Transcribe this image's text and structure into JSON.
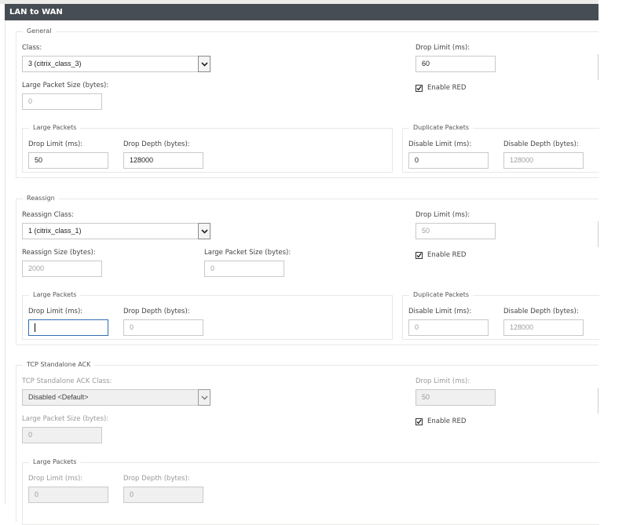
{
  "header": {
    "title": "LAN to WAN"
  },
  "general": {
    "legend": "General",
    "class": {
      "label": "Class:",
      "value": "3 (citrix_class_3)"
    },
    "large_packet_size": {
      "label": "Large Packet Size (bytes):",
      "placeholder": "0"
    },
    "drop_limit": {
      "label": "Drop Limit (ms):",
      "value": "60"
    },
    "enable_red": {
      "label": "Enable RED",
      "checked": true
    },
    "large_packets": {
      "legend": "Large Packets",
      "drop_limit": {
        "label": "Drop Limit (ms):",
        "value": "50"
      },
      "drop_depth": {
        "label": "Drop Depth (bytes):",
        "value": "128000"
      }
    },
    "duplicate_packets": {
      "legend": "Duplicate Packets",
      "disable_limit": {
        "label": "Disable Limit (ms):",
        "value": "0"
      },
      "disable_depth": {
        "label": "Disable Depth (bytes):",
        "placeholder": "128000"
      }
    }
  },
  "reassign": {
    "legend": "Reassign",
    "class": {
      "label": "Reassign Class:",
      "value": "1 (citrix_class_1)"
    },
    "reassign_size": {
      "label": "Reassign Size (bytes):",
      "placeholder": "2000"
    },
    "large_packet_size": {
      "label": "Large Packet Size (bytes):",
      "placeholder": "0"
    },
    "drop_limit": {
      "label": "Drop Limit (ms):",
      "placeholder": "50"
    },
    "enable_red": {
      "label": "Enable RED",
      "checked": true
    },
    "large_packets": {
      "legend": "Large Packets",
      "drop_limit": {
        "label": "Drop Limit (ms):",
        "value": ""
      },
      "drop_depth": {
        "label": "Drop Depth (bytes):",
        "placeholder": "0"
      }
    },
    "duplicate_packets": {
      "legend": "Duplicate Packets",
      "disable_limit": {
        "label": "Disable Limit (ms):",
        "placeholder": "0"
      },
      "disable_depth": {
        "label": "Disable Depth (bytes):",
        "placeholder": "128000"
      }
    }
  },
  "tcp_ack": {
    "legend": "TCP Standalone ACK",
    "class": {
      "label": "TCP Standalone ACK Class:",
      "value": "Disabled <Default>"
    },
    "large_packet_size": {
      "label": "Large Packet Size (bytes):",
      "value": "0"
    },
    "drop_limit": {
      "label": "Drop Limit (ms):",
      "value": "50"
    },
    "enable_red": {
      "label": "Enable RED",
      "checked": true
    },
    "large_packets": {
      "legend": "Large Packets",
      "drop_limit": {
        "label": "Drop Limit (ms):",
        "value": "0"
      },
      "drop_depth": {
        "label": "Drop Depth (bytes):",
        "value": "0"
      }
    }
  }
}
